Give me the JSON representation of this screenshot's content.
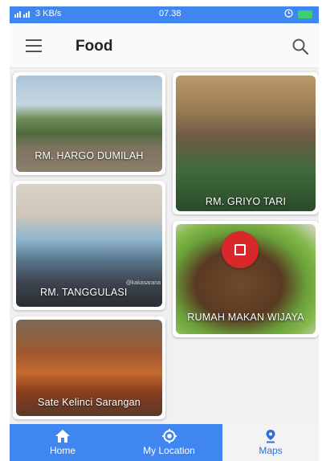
{
  "status": {
    "left": "3 KB/s",
    "time": "07.38"
  },
  "appbar": {
    "title": "Food"
  },
  "cards": [
    {
      "name": "RM. HARGO DUMILAH"
    },
    {
      "name": "RM. GRIYO TARI"
    },
    {
      "name": "RM. TANGGULASI",
      "watermark": "@kakasarana"
    },
    {
      "name": "RUMAH MAKAN WIJAYA"
    },
    {
      "name": "Sate Kelinci Sarangan"
    }
  ],
  "bottom_nav": [
    {
      "label": "Home",
      "icon": "home-icon"
    },
    {
      "label": "My Location",
      "icon": "location-icon"
    },
    {
      "label": "Maps",
      "icon": "map-pin-icon"
    }
  ],
  "colors": {
    "primary": "#3f86f1",
    "record": "#d8282b",
    "active_nav_text": "#2f6fd6"
  }
}
